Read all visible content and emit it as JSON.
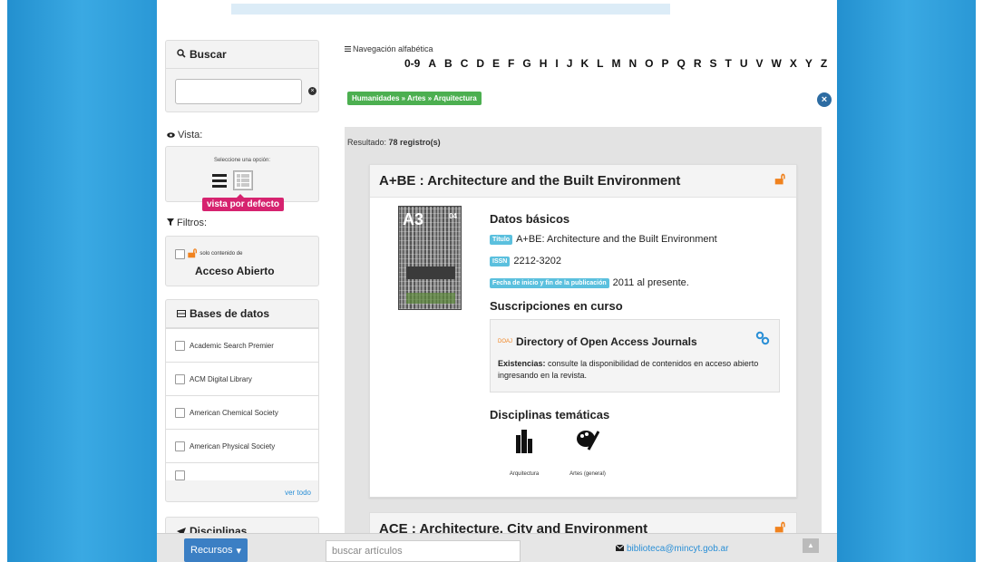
{
  "search": {
    "title": "Buscar",
    "input_value": "",
    "clear_glyph": "×"
  },
  "view": {
    "label": "Vista:",
    "caption": "Seleccione una opción:",
    "default_tag": "vista por defecto",
    "icons": [
      "list-view-icon",
      "table-view-icon",
      "grid-view-icon"
    ]
  },
  "filters": {
    "label": "Filtros:",
    "open_access_small": "solo contenido de",
    "open_access_big": "Acceso Abierto"
  },
  "databases": {
    "title": "Bases de datos",
    "items": [
      "Academic Search Premier",
      "ACM Digital Library",
      "American Chemical Society",
      "American Physical Society"
    ],
    "see_all": "ver todo"
  },
  "disciplines_panel": {
    "title": "Disciplinas"
  },
  "alphabet": {
    "label": "Navegación alfabética",
    "letters": [
      "0-9",
      "A",
      "B",
      "C",
      "D",
      "E",
      "F",
      "G",
      "H",
      "I",
      "J",
      "K",
      "L",
      "M",
      "N",
      "O",
      "P",
      "Q",
      "R",
      "S",
      "T",
      "U",
      "V",
      "W",
      "X",
      "Y",
      "Z"
    ]
  },
  "breadcrumb": "Humanidades » Artes » Arquitectura",
  "results": {
    "prefix": "Resultado:",
    "count": "78 registro(s)"
  },
  "card1": {
    "title": "A+BE : Architecture and the Built Environment",
    "cover_logo": "A3",
    "cover_num": "04",
    "basic_data_title": "Datos básicos",
    "title_tag": "Título",
    "title_value": "A+BE: Architecture and the Built Environment",
    "issn_tag": "ISSN",
    "issn_value": "2212-3202",
    "dates_tag": "Fecha de inicio y fin de la publicación",
    "dates_value": "2011 al presente.",
    "subscriptions_title": "Suscripciones en curso",
    "subscription_small": "DOAJ",
    "subscription_name": "Directory of Open Access Journals",
    "holdings_label": "Existencias:",
    "holdings_text": "consulte la disponibilidad de contenidos en acceso abierto ingresando en la revista.",
    "disciplines_title": "Disciplinas temáticas",
    "discipline_1": "Arquitectura",
    "discipline_2": "Artes (general)"
  },
  "card2": {
    "title": "ACE : Architecture, City and Environment"
  },
  "bottom": {
    "recursos": "Recursos",
    "search_placeholder": "buscar artículos",
    "email": "biblioteca@mincyt.gob.ar"
  },
  "colors": {
    "side_blue": "#2a98d6",
    "breadcrumb_green": "#4caf50",
    "tag_blue": "#5bc0de",
    "default_pink": "#d6236f",
    "oa_orange": "#f0821e",
    "button_blue": "#3b7fc4"
  }
}
